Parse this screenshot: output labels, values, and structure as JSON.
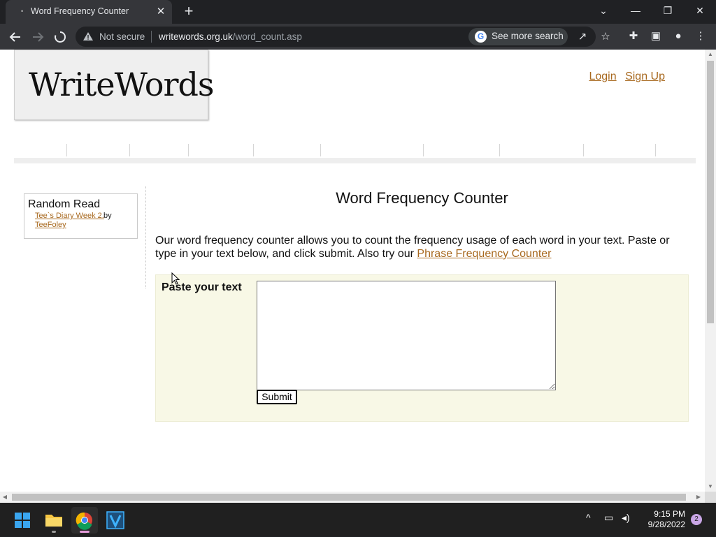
{
  "browser": {
    "tab_title": "Word Frequency Counter",
    "close_tab_glyph": "✕",
    "new_tab_glyph": "+",
    "not_secure": "Not secure",
    "url_host": "writewords.org.uk",
    "url_path": "/word_count.asp",
    "see_more_search": "See more search",
    "window_controls": {
      "tab_search": "⌄",
      "minimize": "—",
      "restore": "❐",
      "close": "✕"
    }
  },
  "page": {
    "logo_text": "WriteWords",
    "auth": {
      "login": "Login",
      "signup": "Sign Up"
    },
    "random_read": {
      "title": "Random Read",
      "link": "Tee`s Diary Week 2.",
      "by": "by",
      "author": "TeeFoley"
    },
    "title": "Word Frequency Counter",
    "intro_text": "Our word frequency counter allows you to count the frequency usage of each word in your text. Paste or type in your text below, and click submit. Also try our ",
    "intro_link": "Phrase Frequency Counter",
    "form": {
      "label": "Paste your text",
      "textarea_value": "",
      "submit_label": "Submit"
    }
  },
  "taskbar": {
    "apps": [
      "start",
      "file-explorer",
      "chrome",
      "vivid"
    ],
    "time": "9:15 PM",
    "date": "9/28/2022",
    "notification_count": "2"
  }
}
